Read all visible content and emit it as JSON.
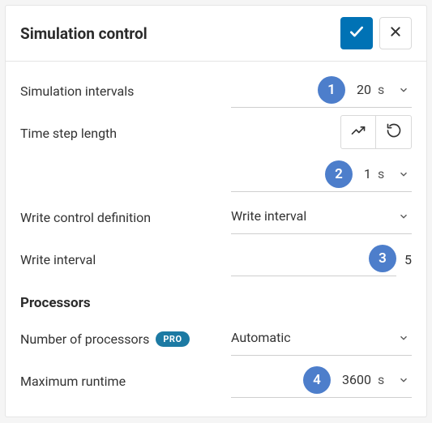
{
  "header": {
    "title": "Simulation control"
  },
  "markers": {
    "m1": "1",
    "m2": "2",
    "m3": "3",
    "m4": "4"
  },
  "rows": {
    "simulation_intervals": {
      "label": "Simulation intervals",
      "value": "20",
      "unit": "s"
    },
    "time_step_length": {
      "label": "Time step length",
      "value": "1",
      "unit": "s"
    },
    "write_control_definition": {
      "label": "Write control definition",
      "selected": "Write interval"
    },
    "write_interval": {
      "label": "Write interval",
      "value": "5"
    },
    "number_of_processors": {
      "label": "Number of processors",
      "badge": "PRO",
      "selected": "Automatic"
    },
    "maximum_runtime": {
      "label": "Maximum runtime",
      "value": "3600",
      "unit": "s"
    }
  },
  "sections": {
    "processors": "Processors"
  }
}
